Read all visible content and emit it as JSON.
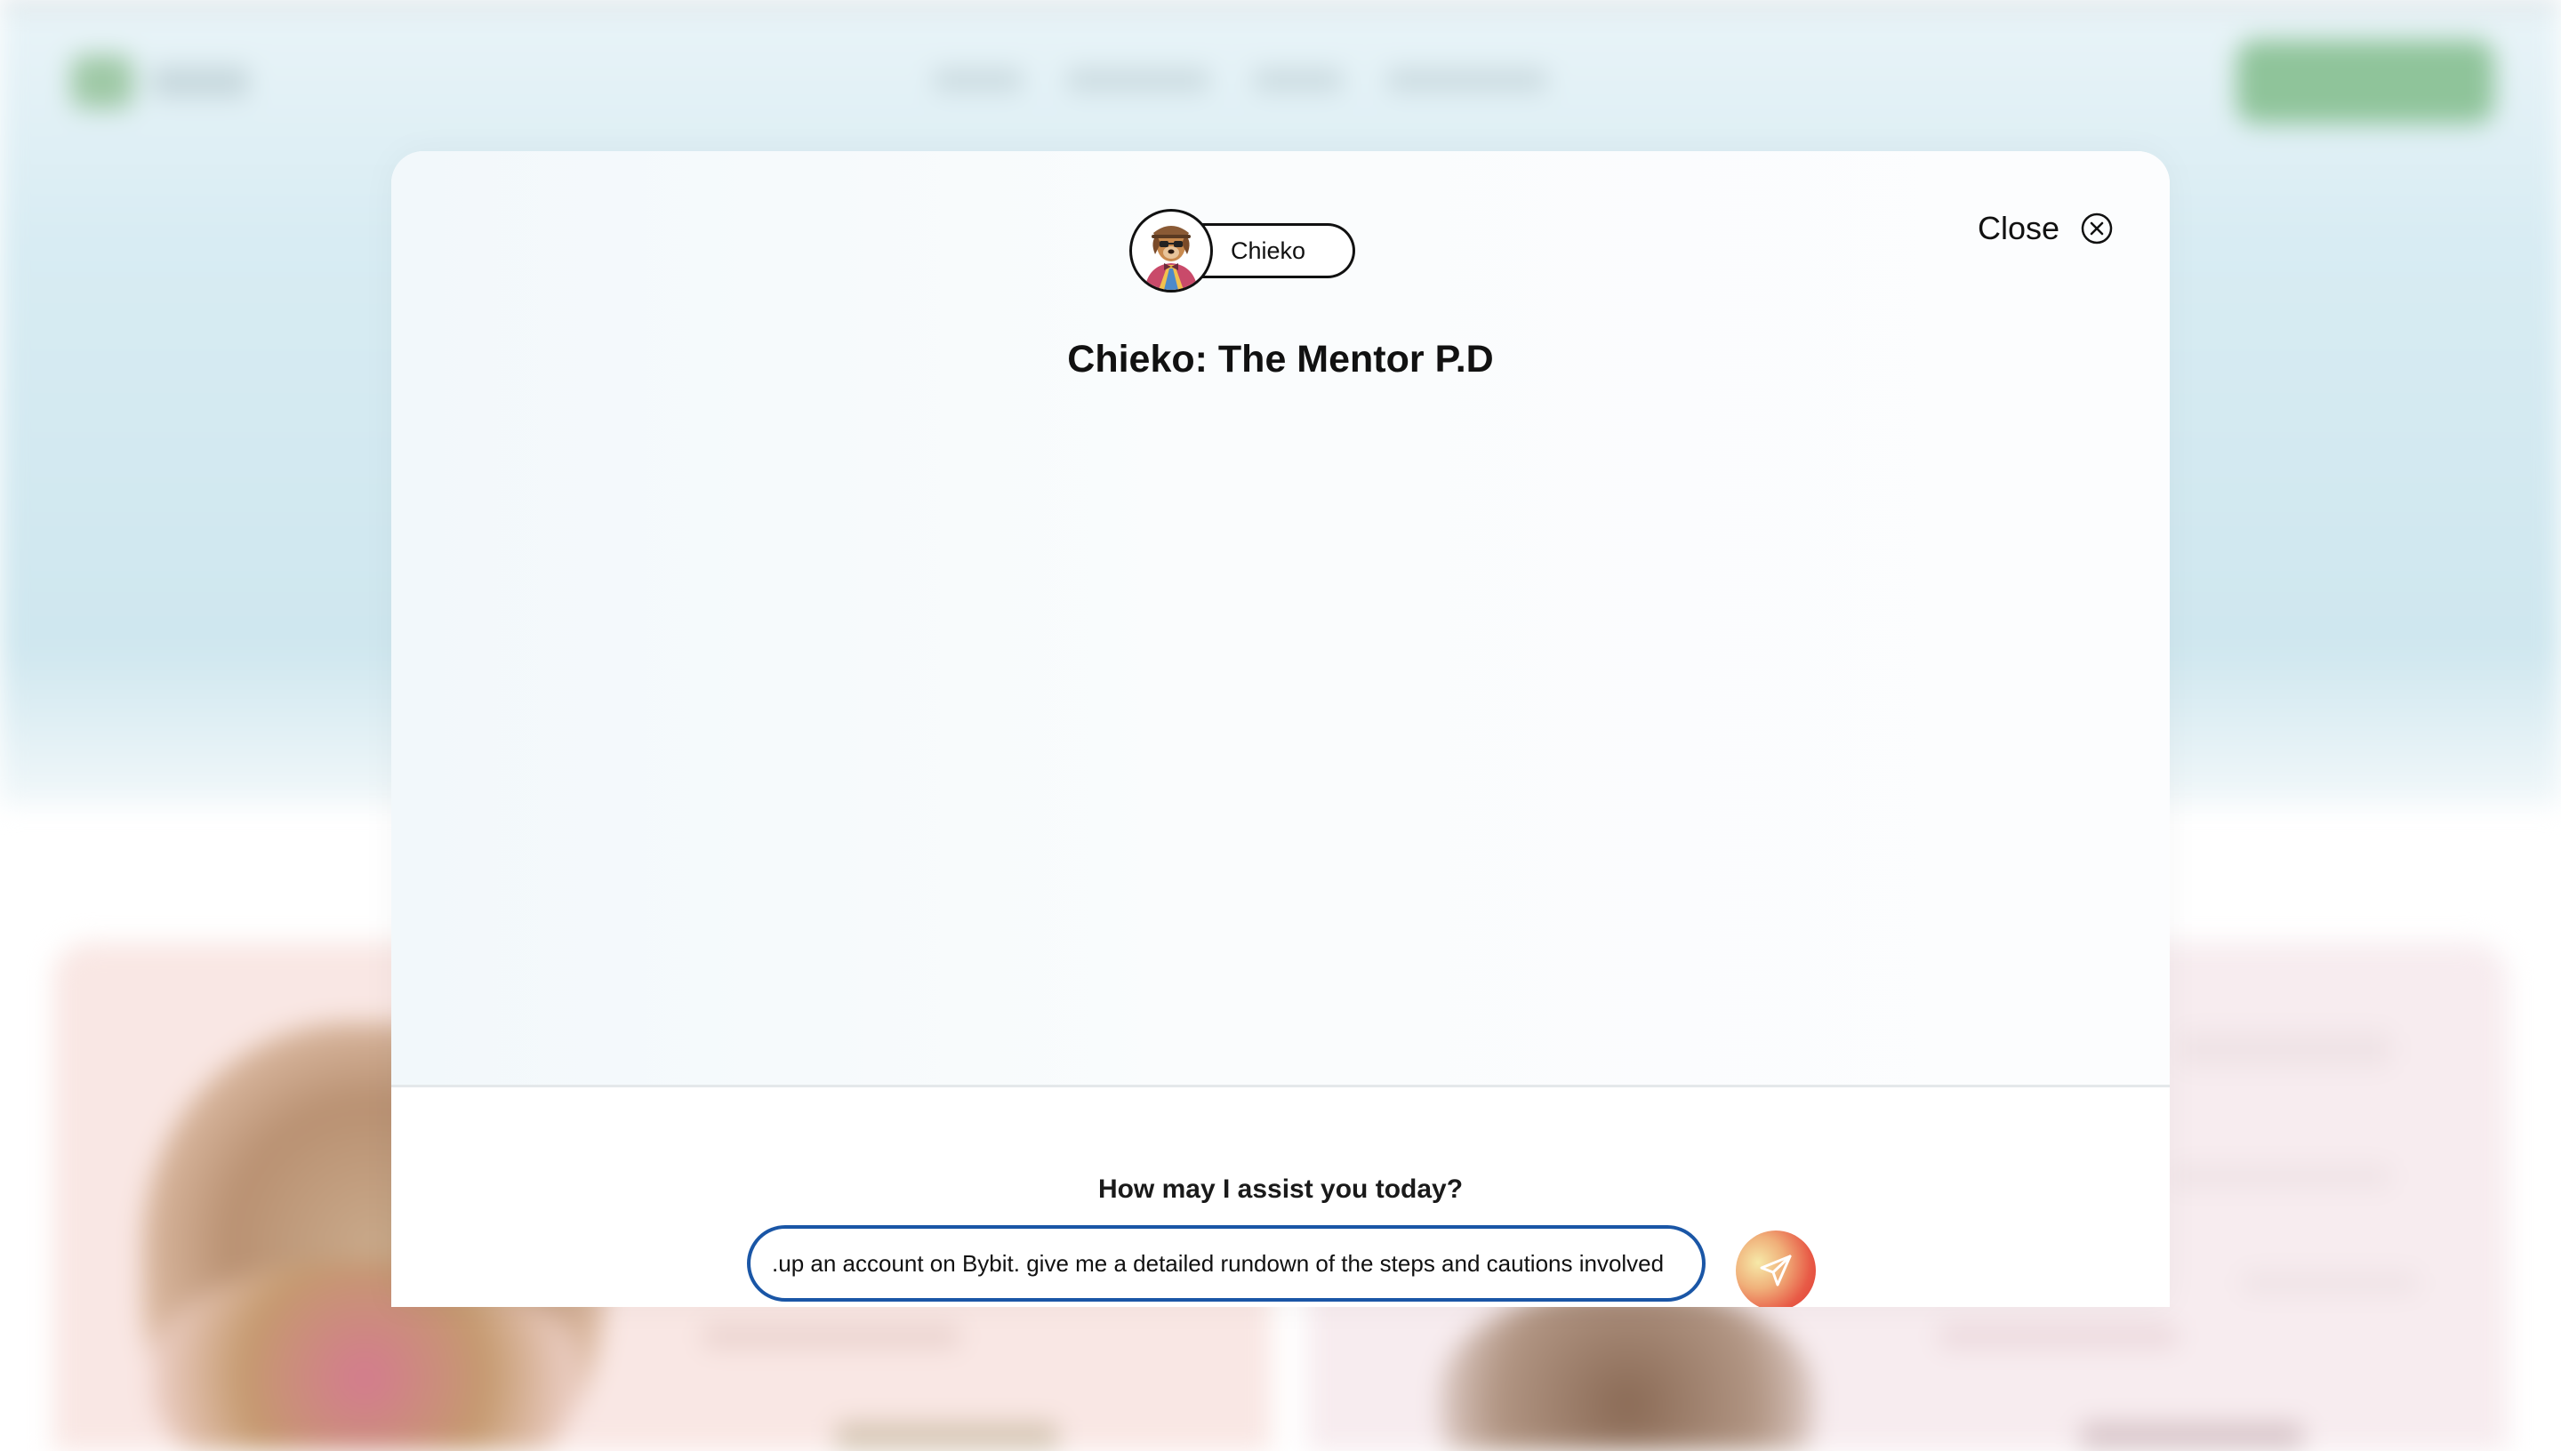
{
  "agent": {
    "name": "Chieko",
    "title": "Chieko: The Mentor P.D"
  },
  "modal": {
    "close_label": "Close"
  },
  "chat": {
    "prompt": "How may I assist you today?",
    "input_value": "up an account on Bybit. give me a detailed rundown of the steps and cautions involved."
  },
  "icons": {
    "close": "close-circle-icon",
    "send": "paper-plane-icon",
    "avatar": "dog-avatar"
  },
  "colors": {
    "input_border": "#1a56a6",
    "send_button_start": "#f6e9a8",
    "send_button_end": "#dd3a33"
  }
}
